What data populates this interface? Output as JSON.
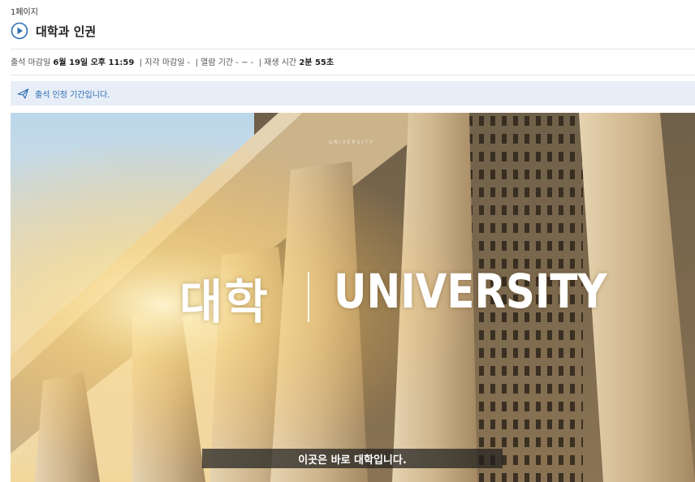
{
  "page": {
    "label": "1페이지"
  },
  "lecture": {
    "title": "대학과 인권"
  },
  "meta": {
    "attendance_deadline_label": "출석 마감일",
    "attendance_deadline_value": "6월 19일 오후 11:59",
    "late_deadline_label": "지각 마감일",
    "late_deadline_value": "-",
    "viewing_period_label": "열람 기간",
    "viewing_period_value": "- ~ -",
    "play_time_label": "재생 시간",
    "play_time_value": "2분 55초"
  },
  "notice": {
    "text": "출석 인정 기간입니다."
  },
  "video": {
    "small_caption": "UNIVERSITY",
    "headline_korean": "대학",
    "headline_english": "UNIVERSITY",
    "subtitle": "이곳은 바로 대학입니다."
  },
  "colors": {
    "accent": "#2f6db3",
    "notice_background": "#e7eef7"
  },
  "icons": {
    "title": "play-circle-icon",
    "notice": "paper-plane-icon"
  }
}
